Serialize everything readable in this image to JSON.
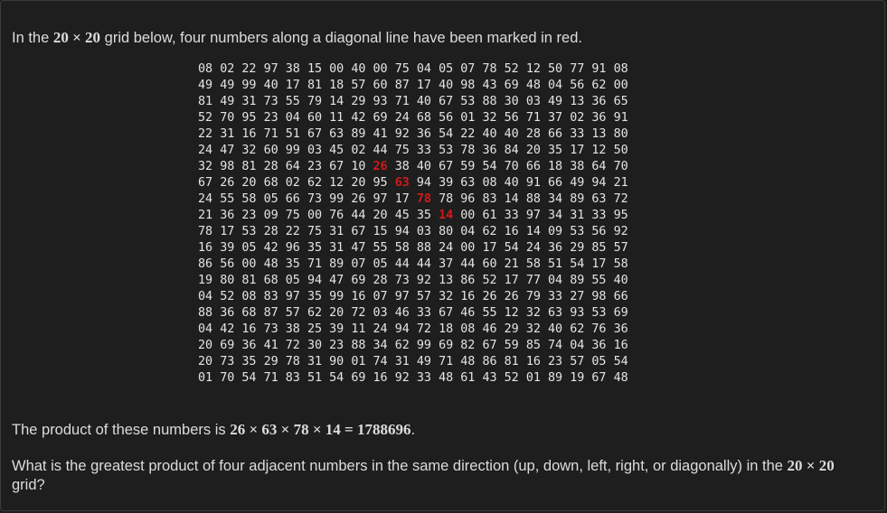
{
  "intro": {
    "before": "In the ",
    "math": "20 × 20",
    "after": " grid below, four numbers along a diagonal line have been marked in red."
  },
  "grid": {
    "rows": [
      "08 02 22 97 38 15 00 40 00 75 04 05 07 78 52 12 50 77 91 08",
      "49 49 99 40 17 81 18 57 60 87 17 40 98 43 69 48 04 56 62 00",
      "81 49 31 73 55 79 14 29 93 71 40 67 53 88 30 03 49 13 36 65",
      "52 70 95 23 04 60 11 42 69 24 68 56 01 32 56 71 37 02 36 91",
      "22 31 16 71 51 67 63 89 41 92 36 54 22 40 40 28 66 33 13 80",
      "24 47 32 60 99 03 45 02 44 75 33 53 78 36 84 20 35 17 12 50",
      "32 98 81 28 64 23 67 10 26 38 40 67 59 54 70 66 18 38 64 70",
      "67 26 20 68 02 62 12 20 95 63 94 39 63 08 40 91 66 49 94 21",
      "24 55 58 05 66 73 99 26 97 17 78 78 96 83 14 88 34 89 63 72",
      "21 36 23 09 75 00 76 44 20 45 35 14 00 61 33 97 34 31 33 95",
      "78 17 53 28 22 75 31 67 15 94 03 80 04 62 16 14 09 53 56 92",
      "16 39 05 42 96 35 31 47 55 58 88 24 00 17 54 24 36 29 85 57",
      "86 56 00 48 35 71 89 07 05 44 44 37 44 60 21 58 51 54 17 58",
      "19 80 81 68 05 94 47 69 28 73 92 13 86 52 17 77 04 89 55 40",
      "04 52 08 83 97 35 99 16 07 97 57 32 16 26 26 79 33 27 98 66",
      "88 36 68 87 57 62 20 72 03 46 33 67 46 55 12 32 63 93 53 69",
      "04 42 16 73 38 25 39 11 24 94 72 18 08 46 29 32 40 62 76 36",
      "20 69 36 41 72 30 23 88 34 62 99 69 82 67 59 85 74 04 36 16",
      "20 73 35 29 78 31 90 01 74 31 49 71 48 86 81 16 23 57 05 54",
      "01 70 54 71 83 51 54 69 16 92 33 48 61 43 52 01 89 19 67 48"
    ],
    "marked": [
      {
        "row": 6,
        "col": 8
      },
      {
        "row": 7,
        "col": 9
      },
      {
        "row": 8,
        "col": 10
      },
      {
        "row": 9,
        "col": 11
      }
    ],
    "colors": {
      "normal": "#e4e4e4",
      "marked": "#d11a1a"
    }
  },
  "product": {
    "before": "The product of these numbers is ",
    "math": "26 × 63 × 78 × 14 = 1788696",
    "after": "."
  },
  "question": {
    "before": "What is the greatest product of four adjacent numbers in the same direction (up, down, left, right, or diagonally) in the ",
    "math": "20 × 20",
    "after": " grid?"
  }
}
